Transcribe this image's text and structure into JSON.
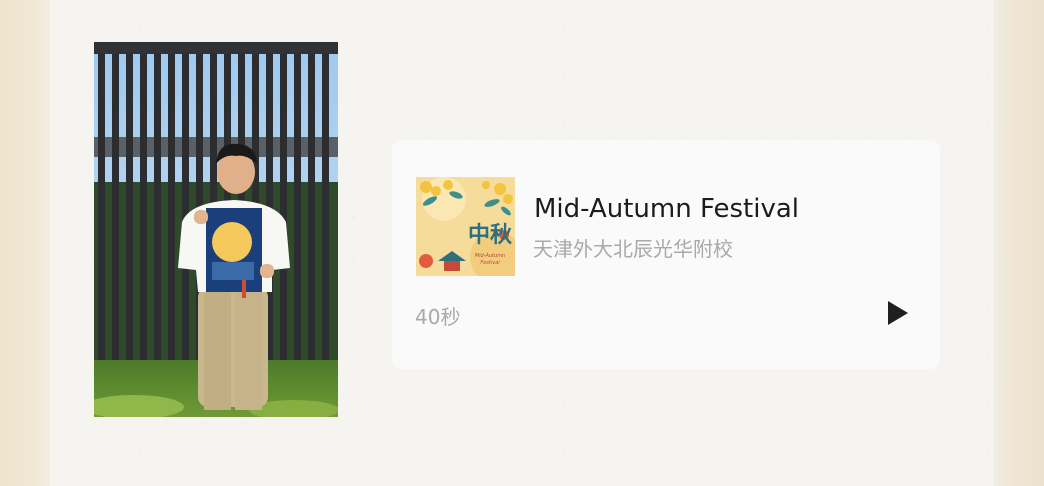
{
  "article": {
    "photo": {
      "icon": "student-holding-mid-autumn-book-photo"
    },
    "audio": {
      "title": "Mid-Autumn Festival",
      "author": "天津外大北辰光华附校",
      "duration": "40秒",
      "cover_icon": "mid-autumn-cover-art",
      "cover_text": "中秋",
      "cover_caption": "Mid-Autumn Festival",
      "play_icon": "play-icon"
    }
  },
  "colors": {
    "card_background": "#fafafa",
    "title_text": "#1c1c1c",
    "muted_text": "#a9a9a9",
    "page_background": "#f6f4f0"
  }
}
